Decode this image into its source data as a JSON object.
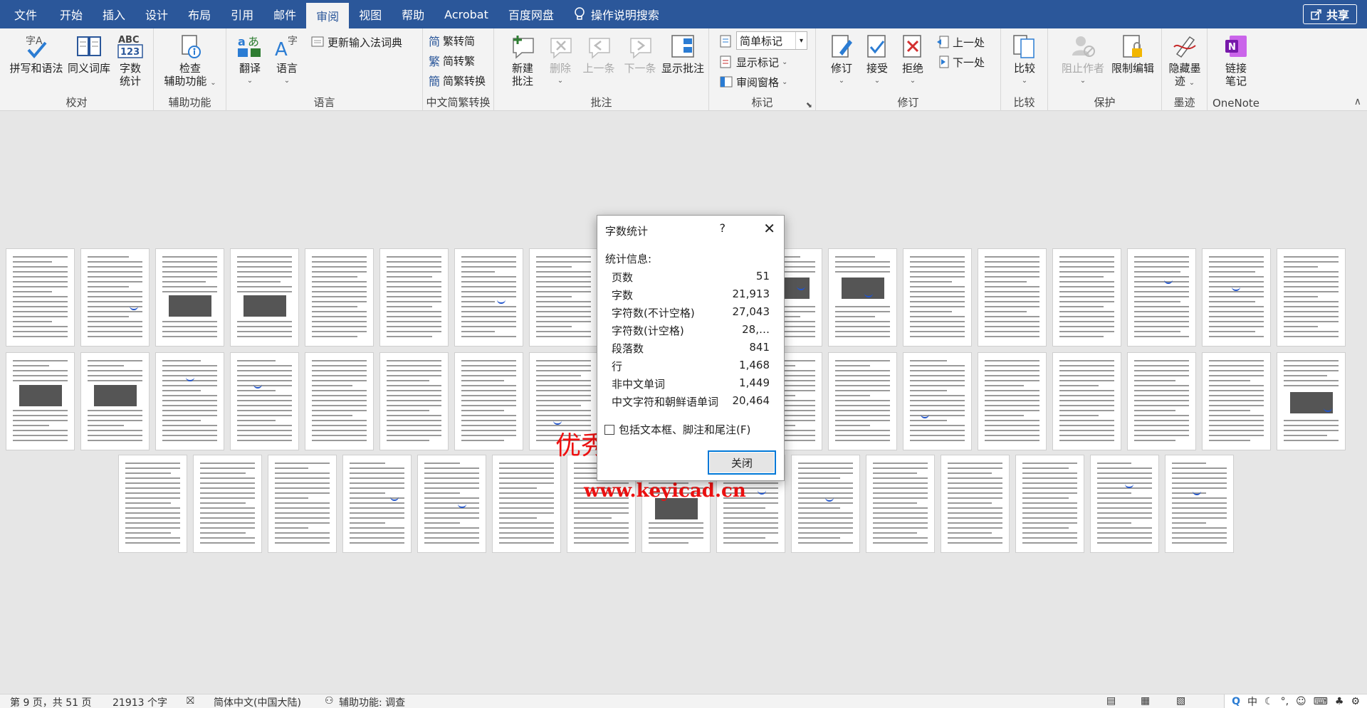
{
  "menubar": {
    "tabs": [
      "文件",
      "开始",
      "插入",
      "设计",
      "布局",
      "引用",
      "邮件",
      "审阅",
      "视图",
      "帮助",
      "Acrobat",
      "百度网盘"
    ],
    "active_tab": "审阅",
    "tell_me": "操作说明搜索",
    "share": "共享"
  },
  "ribbon": {
    "proofing": {
      "label": "校对",
      "spelling": "拼写和语法",
      "thesaurus": "同义词库",
      "word_count_line1": "字数",
      "word_count_line2": "统计"
    },
    "accessibility": {
      "label": "辅助功能",
      "check_line1": "检查",
      "check_line2": "辅助功能"
    },
    "language": {
      "label": "语言",
      "translate": "翻译",
      "language": "语言",
      "update_ime": "更新输入法词典"
    },
    "chinese_conversion": {
      "label": "中文简繁转换",
      "trad_to_simp": "繁转简",
      "simp_to_trad": "简转繁",
      "convert": "简繁转换"
    },
    "comments": {
      "label": "批注",
      "new_line1": "新建",
      "new_line2": "批注",
      "delete": "删除",
      "previous": "上一条",
      "next": "下一条",
      "show": "显示批注"
    },
    "tracking": {
      "label": "标记",
      "markup_select": "简单标记",
      "show_markup": "显示标记",
      "reviewing_pane": "审阅窗格"
    },
    "changes": {
      "label": "修订",
      "track": "修订",
      "accept": "接受",
      "reject": "拒绝",
      "previous": "上一处",
      "next": "下一处"
    },
    "compare": {
      "label": "比较",
      "compare": "比较"
    },
    "protect": {
      "label": "保护",
      "block_authors": "阻止作者",
      "restrict": "限制编辑"
    },
    "ink": {
      "label": "墨迹",
      "hide_line1": "隐藏墨",
      "hide_line2": "迹"
    },
    "onenote": {
      "label": "OneNote",
      "linked_line1": "链接",
      "linked_line2": "笔记"
    }
  },
  "dialog": {
    "title": "字数统计",
    "help": "?",
    "close_x": "✕",
    "section": "统计信息:",
    "stats": [
      {
        "label": "页数",
        "value": "51"
      },
      {
        "label": "字数",
        "value": "21,913"
      },
      {
        "label": "字符数(不计空格)",
        "value": "27,043"
      },
      {
        "label": "字符数(计空格)",
        "value": "28,…"
      },
      {
        "label": "段落数",
        "value": "841"
      },
      {
        "label": "行",
        "value": "1,468"
      },
      {
        "label": "非中文单词",
        "value": "1,449"
      },
      {
        "label": "中文字符和朝鲜语单词",
        "value": "20,464"
      }
    ],
    "checkbox_label": "包括文本框、脚注和尾注(F)",
    "checkbox_checked": false,
    "close_button": "关闭"
  },
  "watermark": {
    "text": "优秀毕业设计资源网",
    "url": "www.keyicad.cn"
  },
  "statusbar": {
    "page": "第 9 页，共 51 页",
    "words": "21913 个字",
    "language": "简体中文(中国大陆)",
    "accessibility": "辅助功能: 调查",
    "ime_lang": "中"
  },
  "colors": {
    "titlebar": "#2b579a",
    "ribbon": "#f3f3f3",
    "canvas": "#e6e6e6",
    "accent": "#0078d7",
    "watermark": "#ee1111"
  }
}
